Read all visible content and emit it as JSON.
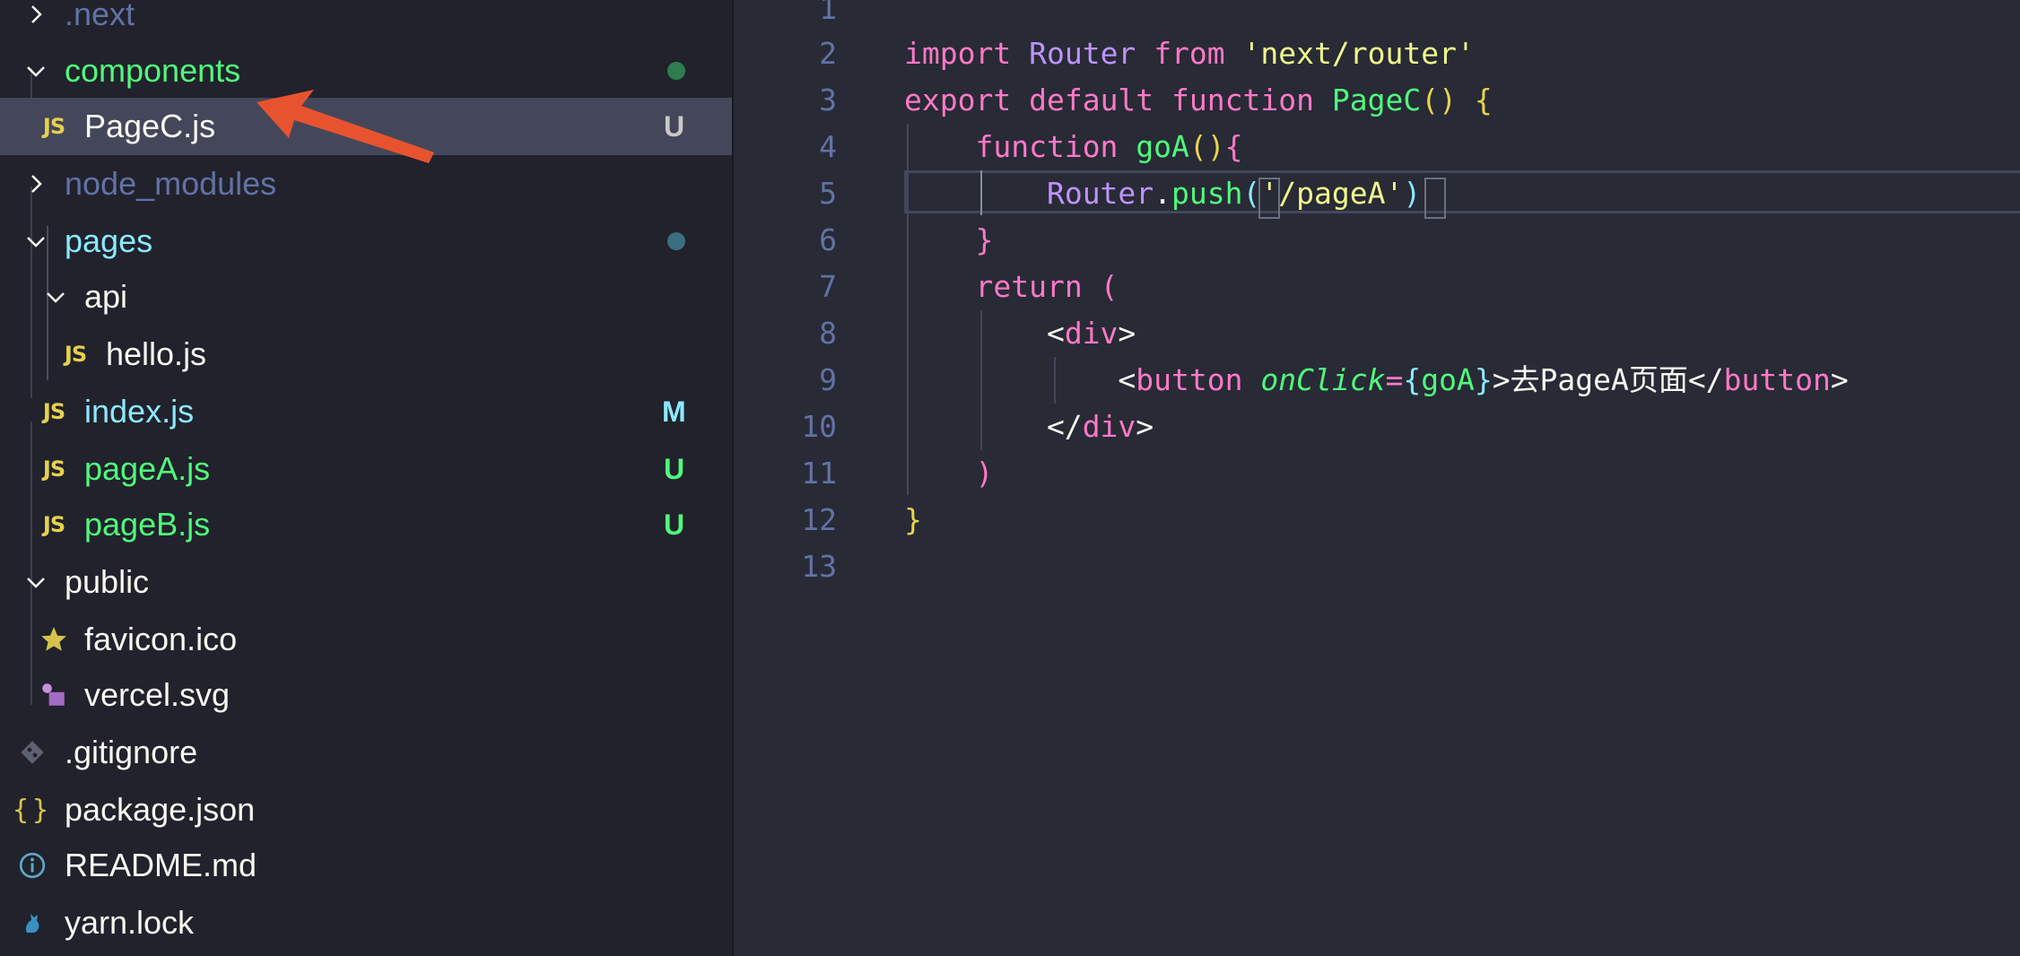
{
  "explorer": {
    "items": [
      {
        "label": ".next",
        "type": "folder-collapsed",
        "color": "#6272a4"
      },
      {
        "label": "components",
        "type": "folder-expanded",
        "color": "#50fa7b",
        "status_dot": "#2e7d4f"
      },
      {
        "label": "PageC.js",
        "type": "js",
        "color": "#f8f8f2",
        "badge": "U",
        "badge_color": "#c9c9c9",
        "selected": true
      },
      {
        "label": "node_modules",
        "type": "folder-collapsed",
        "color": "#6272a4"
      },
      {
        "label": "pages",
        "type": "folder-expanded",
        "color": "#8be9fd",
        "status_dot": "#3b6f80"
      },
      {
        "label": "api",
        "type": "folder-expanded",
        "color": "#f8f8f2"
      },
      {
        "label": "hello.js",
        "type": "js",
        "color": "#f8f8f2"
      },
      {
        "label": "index.js",
        "type": "js",
        "color": "#8be9fd",
        "badge": "M",
        "badge_color": "#8be9fd"
      },
      {
        "label": "pageA.js",
        "type": "js",
        "color": "#50fa7b",
        "badge": "U",
        "badge_color": "#50fa7b"
      },
      {
        "label": "pageB.js",
        "type": "js",
        "color": "#50fa7b",
        "badge": "U",
        "badge_color": "#50fa7b"
      },
      {
        "label": "public",
        "type": "folder-expanded",
        "color": "#f8f8f2"
      },
      {
        "label": "favicon.ico",
        "type": "star",
        "color": "#f8f8f2"
      },
      {
        "label": "vercel.svg",
        "type": "svg",
        "color": "#f8f8f2"
      },
      {
        "label": ".gitignore",
        "type": "git",
        "color": "#f8f8f2"
      },
      {
        "label": "package.json",
        "type": "json",
        "color": "#f8f8f2"
      },
      {
        "label": "README.md",
        "type": "info",
        "color": "#f8f8f2"
      },
      {
        "label": "yarn.lock",
        "type": "yarn",
        "color": "#f8f8f2"
      }
    ]
  },
  "editor": {
    "line_numbers": [
      "1",
      "2",
      "3",
      "4",
      "5",
      "6",
      "7",
      "8",
      "9",
      "10",
      "11",
      "12",
      "13"
    ],
    "lines": [
      "",
      "import Router from 'next/router'",
      "export default function PageC() {",
      "    function goA(){",
      "        Router.push('/pageA')",
      "    }",
      "    return (",
      "        <div>",
      "            <button onClick={goA}>去PageA页面</button>",
      "        </div>",
      "    )",
      "}",
      ""
    ]
  },
  "annotation": {
    "arrow_color": "#e8532f"
  }
}
